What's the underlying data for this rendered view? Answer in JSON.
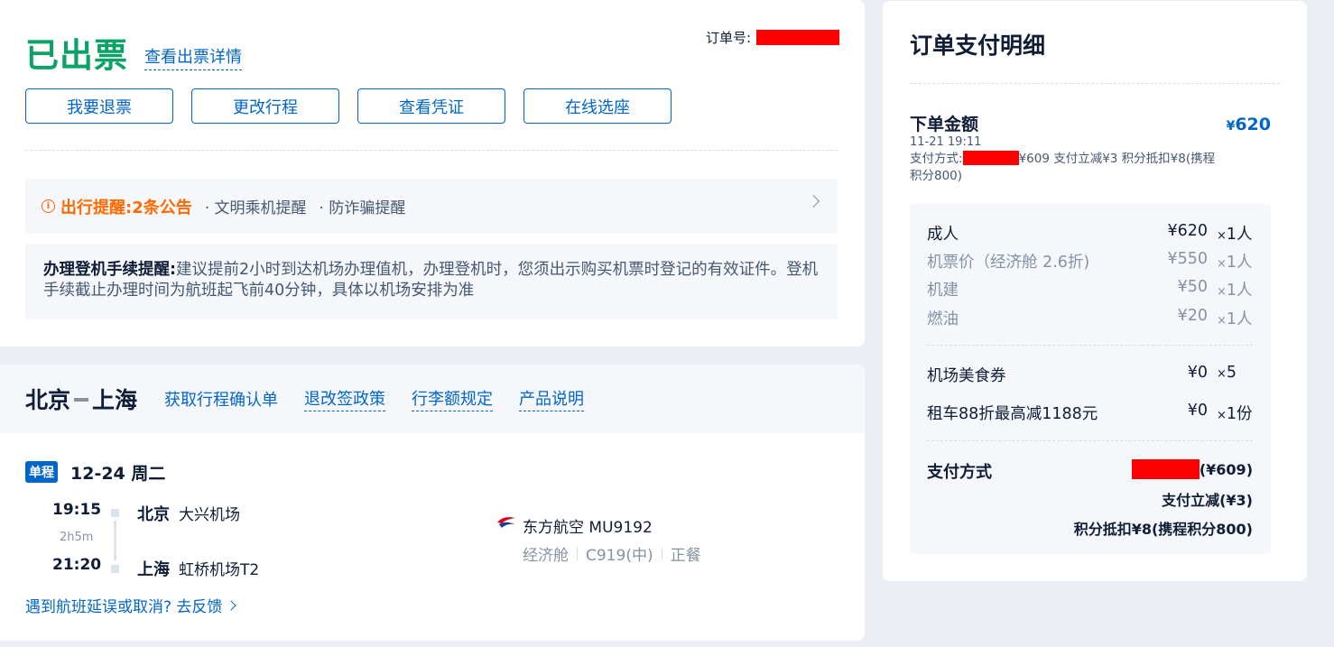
{
  "status": {
    "title": "已出票",
    "detail_link": "查看出票详情",
    "order_no_label": "订单号:",
    "actions": [
      "我要退票",
      "更改行程",
      "查看凭证",
      "在线选座"
    ]
  },
  "reminder": {
    "label": "出行提醒:",
    "count": "2条公告",
    "items": [
      "· 文明乘机提醒",
      "· 防诈骗提醒"
    ]
  },
  "checkin": {
    "label": "办理登机手续提醒:",
    "text": "建议提前2小时到达机场办理值机，办理登机时，您须出示购买机票时登记的有效证件。登机手续截止办理时间为航班起飞前40分钟，具体以机场安排为准"
  },
  "flight": {
    "from": "北京",
    "to": "上海",
    "links": [
      "获取行程确认单",
      "退改签政策",
      "行李额规定",
      "产品说明"
    ],
    "trip_type": "单程",
    "date": "12-24 周二",
    "dep_time": "19:15",
    "duration": "2h5m",
    "arr_time": "21:20",
    "dep_city": "北京",
    "dep_airport": "大兴机场",
    "arr_city": "上海",
    "arr_airport": "虹桥机场T2",
    "airline": "东方航空 MU9192",
    "cabin": "经济舱",
    "aircraft": "C919(中)",
    "meal": "正餐",
    "feedback": "遇到航班延误或取消? 去反馈"
  },
  "payment": {
    "title": "订单支付明细",
    "order_amount_label": "下单金额",
    "currency": "¥",
    "order_amount": "620",
    "order_time": "11-21 19:11",
    "method_prefix": "支付方式:",
    "method_suffix": "¥609 支付立减¥3 积分抵扣¥8(携程积分800)",
    "rows": [
      {
        "name": "成人",
        "value": "¥620",
        "qty": "1人"
      },
      {
        "name": "机票价（经济舱 2.6折)",
        "value": "¥550",
        "qty": "1人"
      },
      {
        "name": "机建",
        "value": "¥50",
        "qty": "1人"
      },
      {
        "name": "燃油",
        "value": "¥20",
        "qty": "1人"
      }
    ],
    "extras": [
      {
        "name": "机场美食券",
        "value": "¥0",
        "qty": "5"
      },
      {
        "name": "租车88折最高减1188元",
        "value": "¥0",
        "qty": "1份"
      }
    ],
    "qty_mark": "×",
    "method_label": "支付方式",
    "method_amount": "(¥609)",
    "instant_discount": "支付立减(¥3)",
    "points_deduct": "积分抵扣¥8(携程积分800)"
  },
  "colors": {
    "success": "#0ba267",
    "link": "#0066cc",
    "warning": "#ff6a00",
    "redaction": "#ff0000",
    "background": "#eceef5"
  }
}
